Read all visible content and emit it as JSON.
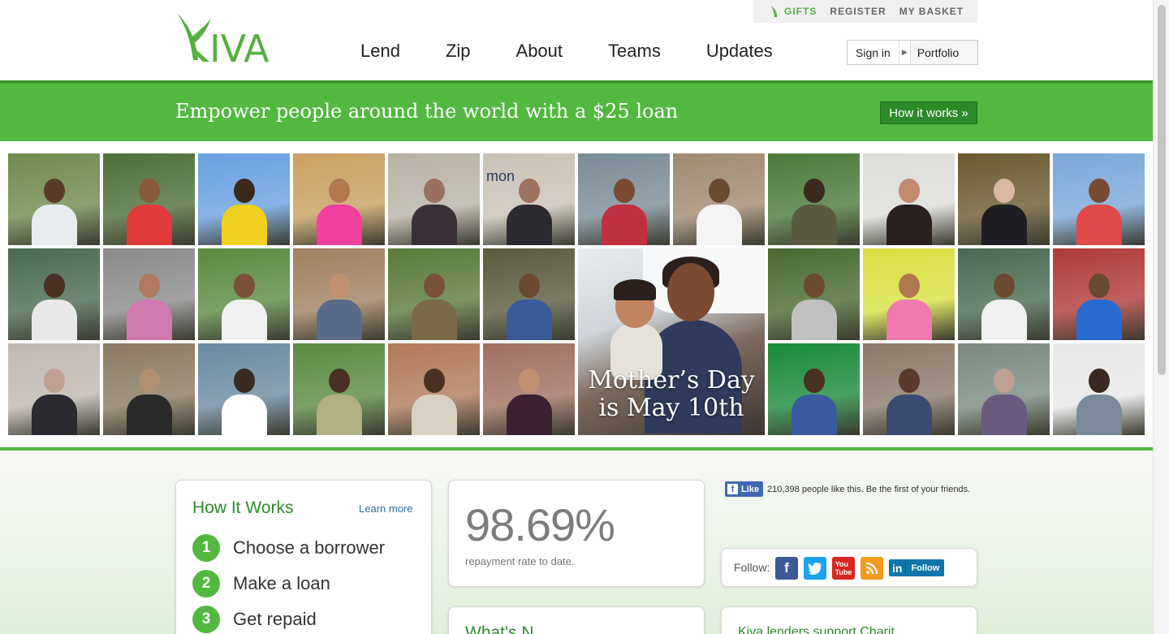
{
  "header": {
    "logo_text": "KIVA",
    "topbar": {
      "gifts": "GIFTS",
      "register": "REGISTER",
      "basket": "MY BASKET"
    },
    "nav": [
      "Lend",
      "Zip",
      "About",
      "Teams",
      "Updates"
    ],
    "signin": "Sign in",
    "portfolio": "Portfolio"
  },
  "banner": {
    "headline": "Empower people around the world with a $25 loan",
    "how_button": "How it works »"
  },
  "feature": {
    "caption_line1": "Mother’s Day",
    "caption_line2": "is May 10th",
    "tile_text": "mon"
  },
  "how_it_works": {
    "title": "How It Works",
    "learn_more": "Learn more",
    "steps": [
      {
        "num": "1",
        "text": "Choose a borrower"
      },
      {
        "num": "2",
        "text": "Make a loan"
      },
      {
        "num": "3",
        "text": "Get repaid"
      }
    ]
  },
  "stats": {
    "rate": "98.69%",
    "label": "repayment rate to date."
  },
  "facebook": {
    "like_label": "Like",
    "text": "210,398 people like this. Be the first of your friends."
  },
  "follow": {
    "label": "Follow:",
    "linkedin_label": "Follow"
  },
  "news": {
    "title": "What's N"
  },
  "blog": {
    "title": "Kiva lenders support Charit"
  },
  "colors": {
    "brand_green": "#52b840",
    "dark_green": "#2d8a2b"
  }
}
